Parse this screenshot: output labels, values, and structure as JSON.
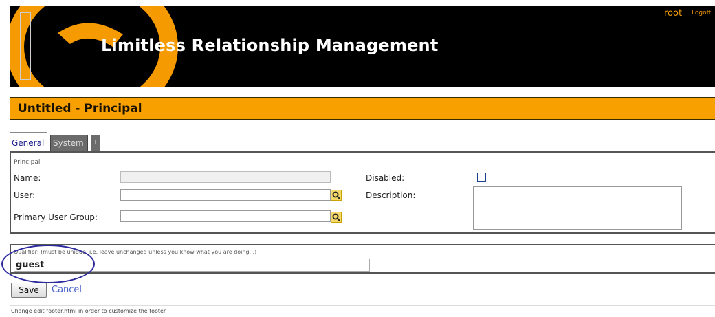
{
  "header": {
    "brand": "Limitless Relationship Management",
    "user": "root",
    "logoff": "Logoff",
    "brand_color": "#f59a00"
  },
  "page": {
    "title": "Untitled - Principal"
  },
  "tabs": [
    {
      "label": "General",
      "active": true
    },
    {
      "label": "System",
      "active": false
    },
    {
      "label": "+",
      "active": false
    }
  ],
  "form": {
    "section": "Principal",
    "name_label": "Name:",
    "name_value": "",
    "user_label": "User:",
    "user_value": "",
    "primary_group_label": "Primary User Group:",
    "primary_group_value": "",
    "disabled_label": "Disabled:",
    "disabled_checked": false,
    "description_label": "Description:",
    "description_value": ""
  },
  "qualifier": {
    "hint": "Qualifier: (must be unique, i.e. leave unchanged unless you know what you are doing...)",
    "value": "guest"
  },
  "actions": {
    "save": "Save",
    "cancel": "Cancel"
  },
  "footer": {
    "text": "Change edit-footer.html in order to customize the footer"
  }
}
